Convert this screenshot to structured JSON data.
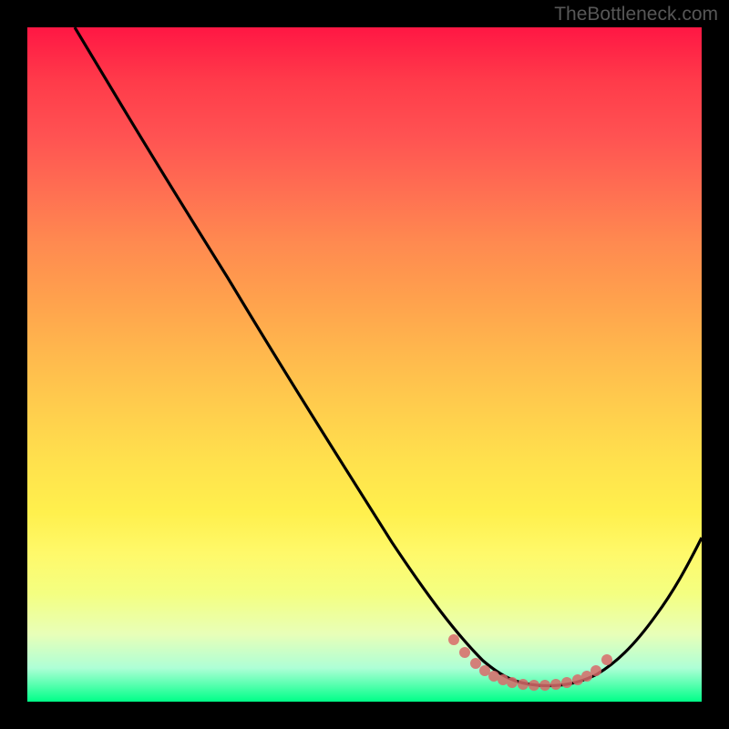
{
  "watermark": "TheBottleneck.com",
  "chart_data": {
    "type": "line",
    "title": "",
    "xlabel": "",
    "ylabel": "",
    "xlim": [
      0,
      100
    ],
    "ylim": [
      0,
      100
    ],
    "series": [
      {
        "name": "bottleneck-curve",
        "x": [
          7,
          12,
          18,
          25,
          32,
          40,
          48,
          56,
          62,
          66,
          70,
          74,
          78,
          82,
          85,
          88,
          92,
          96,
          100
        ],
        "y": [
          100,
          95,
          87,
          77,
          67,
          55,
          43,
          31,
          22,
          16,
          11,
          7,
          4,
          3,
          3,
          5,
          10,
          18,
          27
        ]
      }
    ],
    "markers": {
      "name": "optimal-range-markers",
      "x": [
        63,
        65,
        67,
        68,
        69,
        70,
        71,
        72,
        74,
        76,
        78,
        80,
        82,
        83,
        84,
        85
      ],
      "y": [
        14,
        11,
        9,
        8,
        7,
        6.5,
        6,
        5.5,
        5,
        4.5,
        4,
        4,
        4.5,
        5,
        6,
        7
      ]
    },
    "gradient_colors": {
      "top": "#ff1744",
      "middle": "#ffe04d",
      "bottom": "#00ff88"
    }
  }
}
